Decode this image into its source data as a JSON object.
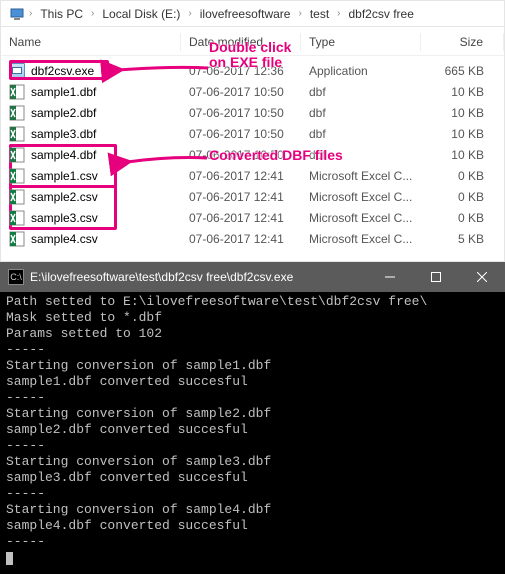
{
  "breadcrumb": {
    "root_icon": "pc",
    "items": [
      "This PC",
      "Local Disk (E:)",
      "ilovefreesoftware",
      "test",
      "dbf2csv free"
    ]
  },
  "columns": {
    "name": "Name",
    "date": "Date modified",
    "type": "Type",
    "size": "Size"
  },
  "files": [
    {
      "icon": "exe",
      "name": "dbf2csv.exe",
      "date": "07-06-2017 12:36",
      "type": "Application",
      "size": "665 KB"
    },
    {
      "icon": "dbf",
      "name": "sample1.dbf",
      "date": "07-06-2017 10:50",
      "type": "dbf",
      "size": "10 KB"
    },
    {
      "icon": "dbf",
      "name": "sample2.dbf",
      "date": "07-06-2017 10:50",
      "type": "dbf",
      "size": "10 KB"
    },
    {
      "icon": "dbf",
      "name": "sample3.dbf",
      "date": "07-06-2017 10:50",
      "type": "dbf",
      "size": "10 KB"
    },
    {
      "icon": "dbf",
      "name": "sample4.dbf",
      "date": "07-06-2017 10:50",
      "type": "dbf",
      "size": "10 KB"
    },
    {
      "icon": "csv",
      "name": "sample1.csv",
      "date": "07-06-2017 12:41",
      "type": "Microsoft Excel C...",
      "size": "0 KB"
    },
    {
      "icon": "csv",
      "name": "sample2.csv",
      "date": "07-06-2017 12:41",
      "type": "Microsoft Excel C...",
      "size": "0 KB"
    },
    {
      "icon": "csv",
      "name": "sample3.csv",
      "date": "07-06-2017 12:41",
      "type": "Microsoft Excel C...",
      "size": "0 KB"
    },
    {
      "icon": "csv",
      "name": "sample4.csv",
      "date": "07-06-2017 12:41",
      "type": "Microsoft Excel C...",
      "size": "5 KB"
    }
  ],
  "annotations": {
    "a1_l1": "Double click",
    "a1_l2": "on EXE file",
    "a2": "Converted DBF files"
  },
  "console": {
    "title": "E:\\ilovefreesoftware\\test\\dbf2csv free\\dbf2csv.exe",
    "lines": [
      "Path setted to E:\\ilovefreesoftware\\test\\dbf2csv free\\",
      "Mask setted to *.dbf",
      "Params setted to 102",
      "-----",
      "Starting conversion of sample1.dbf",
      "sample1.dbf converted succesful",
      "-----",
      "Starting conversion of sample2.dbf",
      "sample2.dbf converted succesful",
      "-----",
      "Starting conversion of sample3.dbf",
      "sample3.dbf converted succesful",
      "-----",
      "Starting conversion of sample4.dbf",
      "sample4.dbf converted succesful",
      "-----"
    ]
  }
}
